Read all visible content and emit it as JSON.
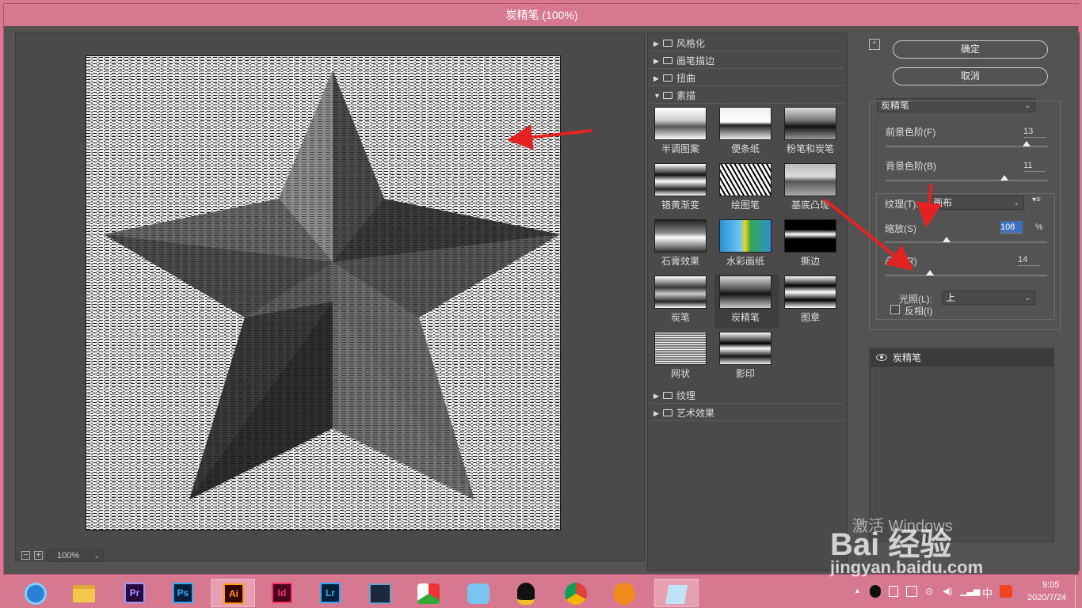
{
  "dialog": {
    "title": "炭精笔 (100%)"
  },
  "preview": {
    "zoom_minus": "−",
    "zoom_plus": "+",
    "zoom_value": "100%"
  },
  "gallery": {
    "categories_top": [
      {
        "label": "风格化",
        "expanded": false
      },
      {
        "label": "画笔描边",
        "expanded": false
      },
      {
        "label": "扭曲",
        "expanded": false
      },
      {
        "label": "素描",
        "expanded": true
      }
    ],
    "filters": [
      {
        "label": "半调图案"
      },
      {
        "label": "便条纸"
      },
      {
        "label": "粉笔和炭笔"
      },
      {
        "label": "铬黄渐变"
      },
      {
        "label": "绘图笔"
      },
      {
        "label": "基底凸现"
      },
      {
        "label": "石膏效果"
      },
      {
        "label": "水彩画纸"
      },
      {
        "label": "撕边"
      },
      {
        "label": "炭笔"
      },
      {
        "label": "炭精笔",
        "selected": true
      },
      {
        "label": "图章"
      },
      {
        "label": "网状"
      },
      {
        "label": "影印"
      }
    ],
    "categories_bottom": [
      {
        "label": "纹理",
        "expanded": false
      },
      {
        "label": "艺术效果",
        "expanded": false
      }
    ]
  },
  "actions": {
    "ok_label": "确定",
    "cancel_label": "取消",
    "collapse_symbol": "⌃"
  },
  "settings": {
    "filter_select": "炭精笔",
    "foreground_label": "前景色阶(F)",
    "foreground_value": "13",
    "background_label": "背景色阶(B)",
    "background_value": "11",
    "texture_label": "纹理(T):",
    "texture_value": "画布",
    "scale_label": "缩放(S)",
    "scale_value": "108",
    "scale_unit": "%",
    "relief_label": "凸现(R)",
    "relief_value": "14",
    "light_label": "光照(L):",
    "light_value": "上",
    "invert_label": "反相(I)",
    "invert_checked": false,
    "foreground_level": 0.87,
    "background_level": 0.73,
    "scale_level": 0.38,
    "relief_level": 0.28
  },
  "layers": {
    "items": [
      {
        "label": "炭精笔",
        "visible": true
      }
    ]
  },
  "taskbar": {
    "apps": [
      {
        "name": "browser-360",
        "label": ""
      },
      {
        "name": "file-explorer",
        "label": ""
      },
      {
        "name": "premiere",
        "label": "Pr",
        "color": "#9999ff"
      },
      {
        "name": "photoshop",
        "label": "Ps",
        "color": "#31a8ff"
      },
      {
        "name": "illustrator",
        "label": "Ai",
        "color": "#ff9a00",
        "active": true
      },
      {
        "name": "indesign",
        "label": "Id",
        "color": "#ff3366"
      },
      {
        "name": "lightroom",
        "label": "Lr",
        "color": "#31a8ff"
      },
      {
        "name": "video-editor",
        "label": ""
      },
      {
        "name": "app-colorful",
        "label": ""
      },
      {
        "name": "app-blue",
        "label": ""
      },
      {
        "name": "qq",
        "label": ""
      },
      {
        "name": "chrome",
        "label": ""
      },
      {
        "name": "app-orange",
        "label": ""
      },
      {
        "name": "notepad",
        "label": "",
        "active": true
      }
    ],
    "ime": "中",
    "time": "9:05",
    "date": "2020/7/24"
  },
  "watermark": {
    "activate_text": "激活 Windows",
    "brand": "Bai 经验",
    "url": "jingyan.baidu.com"
  },
  "colors": {
    "chrome_pink": "#d6788f",
    "panel_bg": "#535353",
    "annotation_red": "#e32222"
  }
}
